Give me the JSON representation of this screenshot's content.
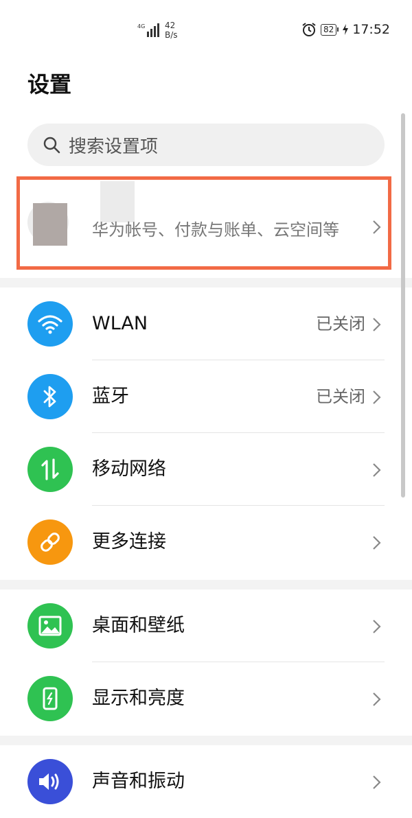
{
  "status_bar": {
    "network_type": "4G",
    "net_speed_value": "42",
    "net_speed_unit": "B/s",
    "battery_level": "82",
    "time": "17:52"
  },
  "title": "设置",
  "search": {
    "placeholder": "搜索设置项"
  },
  "account": {
    "description": "华为帐号、付款与账单、云空间等"
  },
  "items": [
    {
      "label": "WLAN",
      "status": "已关闭",
      "icon": "wifi-icon",
      "color": "#1e9ef0"
    },
    {
      "label": "蓝牙",
      "status": "已关闭",
      "icon": "bluetooth-icon",
      "color": "#1e9ef0"
    },
    {
      "label": "移动网络",
      "status": "",
      "icon": "mobile-data-icon",
      "color": "#2fc252"
    },
    {
      "label": "更多连接",
      "status": "",
      "icon": "link-icon",
      "color": "#f7970f"
    },
    {
      "label": "桌面和壁纸",
      "status": "",
      "icon": "wallpaper-icon",
      "color": "#2fc252"
    },
    {
      "label": "显示和亮度",
      "status": "",
      "icon": "display-icon",
      "color": "#2fc252"
    },
    {
      "label": "声音和振动",
      "status": "",
      "icon": "sound-icon",
      "color": "#3a4fd8"
    }
  ],
  "accent_color": "#f26a45"
}
